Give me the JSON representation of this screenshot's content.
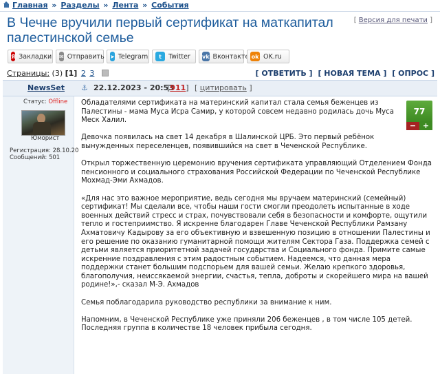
{
  "breadcrumb": {
    "items": [
      "Главная",
      "Разделы",
      "Лента",
      "События"
    ],
    "separator": "»"
  },
  "title": "В Чечне вручили первый сертификат на маткапитал палестинской семье",
  "print_link": {
    "bracket_open": "[",
    "label": "Версия для печати",
    "bracket_close": "]"
  },
  "share": [
    {
      "label": "Закладки",
      "icon": "yandex-bookmarks-icon",
      "color": "#cc0000",
      "glyph": "Я"
    },
    {
      "label": "Отправить",
      "icon": "mail-icon",
      "color": "#8a8a8a",
      "glyph": "✉"
    },
    {
      "label": "Telegram",
      "icon": "telegram-icon",
      "color": "#2aa3dd",
      "glyph": "➤"
    },
    {
      "label": "Twitter",
      "icon": "twitter-icon",
      "color": "#2aa9e0",
      "glyph": "t"
    },
    {
      "label": "Вконтакте",
      "icon": "vk-icon",
      "color": "#4a76a8",
      "glyph": "vk"
    },
    {
      "label": "OK.ru",
      "icon": "odnoklassniki-icon",
      "color": "#ee8208",
      "glyph": "ok"
    }
  ],
  "pagination": {
    "label": "Страницы:",
    "total": "(3)",
    "current": "[1]",
    "pages": [
      "2",
      "3"
    ]
  },
  "actions": {
    "reply": "[ ОТВЕТИТЬ ]",
    "new_topic": "[ НОВАЯ ТЕМА ]",
    "poll": "[ ОПРОС ]"
  },
  "post": {
    "author": "NewsSet",
    "date": "22.12.2023 - 20:53",
    "count_open": "[",
    "count": "911",
    "count_close": "]",
    "quote": "[ цитировать ]",
    "quote_label": "цитировать",
    "status_label": "Статус:",
    "status_value": "Offline",
    "rank": "Юморист",
    "registration": "Регистрация: 28.10.20",
    "messages": "Сообщений: 501",
    "rating": "77",
    "rating_minus": "−",
    "rating_plus": "+",
    "paragraphs": [
      "Обладателями сертификата на материнский капитал стала семья беженцев из Палестины - мама Муса Исра Самир, у которой совсем недавно родилась дочь Муса Меск Халил.",
      "Девочка появилась на свет 14 декабря в Шалинской ЦРБ. Это первый ребёнок вынужденных переселенцев, появившийся на свет в Чеченской Республике.",
      "Открыл торжественную церемонию вручения сертификата управляющий Отделением Фонда пенсионного и социального страхования Российской Федерации по Чеченской Республике Мохмад-Эми Ахмадов.",
      "«Для нас это важное мероприятие, ведь сегодня мы вручаем материнский (семейный) сертификат! Мы сделали все, чтобы наши гости смогли преодолеть испытанные в ходе военных действий стресс и страх, почувствовали себя в безопасности и комфорте, ощутили тепло и гостеприимство. Я искренне благодарен Главе Чеченской Республики Рамзану Ахматовичу Кадырову за его объективную и взвешенную позицию в отношении Палестины и его решение по оказанию гуманитарной помощи жителям Сектора Газа. Поддержка семей с детьми является приоритетной задачей государства и Социального фонда. Примите самые искренние поздравления с этим радостным событием. Надеемся, что данная мера поддержки станет большим подспорьем для вашей семьи. Желаю крепкого здоровья, благополучия, неиссякаемой энергии, счастья, тепла, доброты и скорейшего мира на вашей родине!»,- сказал М-Э. Ахмадов",
      "Семья поблагодарила руководство республики за внимание к ним.",
      "Напомним, в Чеченской Республике уже приняли 206 беженцев , в том числе 105 детей. Последняя группа в количестве 18 человек прибыла сегодня."
    ]
  }
}
